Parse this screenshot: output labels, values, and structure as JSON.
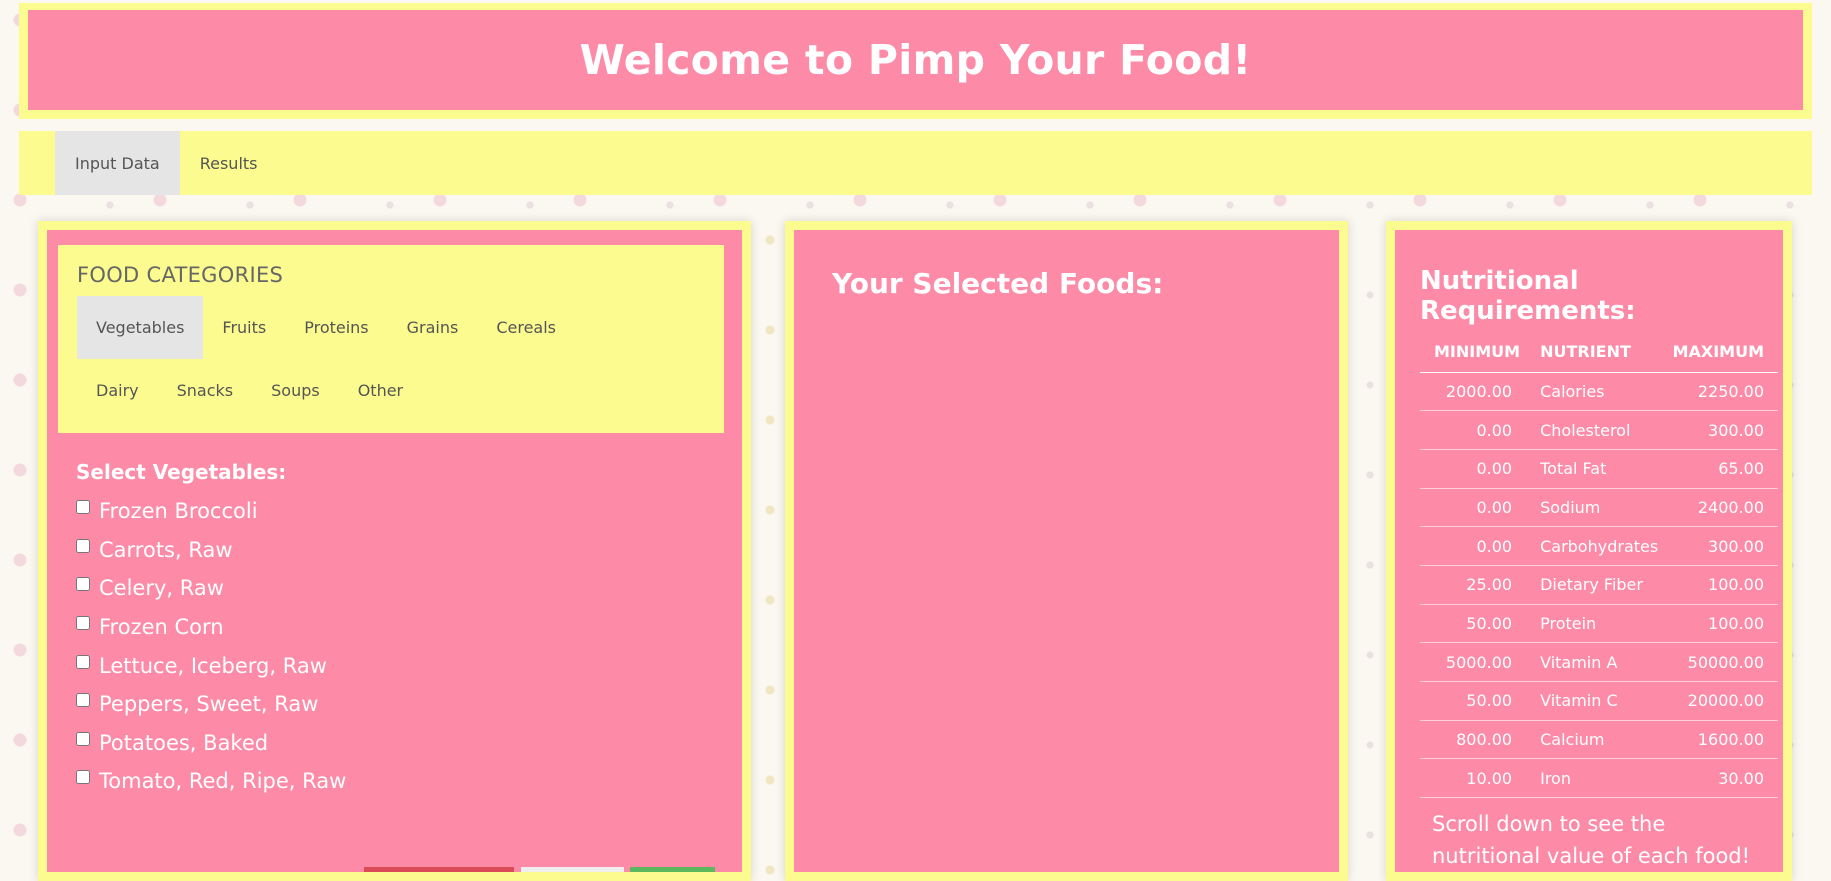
{
  "header": {
    "title": "Welcome to Pimp Your Food!"
  },
  "nav": {
    "tabs": [
      "Input Data",
      "Results"
    ]
  },
  "categories": {
    "title": "FOOD CATEGORIES",
    "tabs": [
      "Vegetables",
      "Fruits",
      "Proteins",
      "Grains",
      "Cereals",
      "Dairy",
      "Snacks",
      "Soups",
      "Other"
    ],
    "active": "Vegetables"
  },
  "selection": {
    "heading": "Select Vegetables:",
    "items": [
      "Frozen Broccoli",
      "Carrots, Raw",
      "Celery, Raw",
      "Frozen Corn",
      "Lettuce, Iceberg, Raw",
      "Peppers, Sweet, Raw",
      "Potatoes, Baked",
      "Tomato, Red, Ripe, Raw"
    ]
  },
  "selected": {
    "title": "Your Selected Foods:"
  },
  "requirements": {
    "title": "Nutritional Requirements:",
    "headers": {
      "min": "MINIMUM",
      "nutrient": "NUTRIENT",
      "max": "MAXIMUM"
    },
    "rows": [
      {
        "min": "2000.00",
        "nutrient": "Calories",
        "max": "2250.00"
      },
      {
        "min": "0.00",
        "nutrient": "Cholesterol",
        "max": "300.00"
      },
      {
        "min": "0.00",
        "nutrient": "Total Fat",
        "max": "65.00"
      },
      {
        "min": "0.00",
        "nutrient": "Sodium",
        "max": "2400.00"
      },
      {
        "min": "0.00",
        "nutrient": "Carbohydrates",
        "max": "300.00"
      },
      {
        "min": "25.00",
        "nutrient": "Dietary Fiber",
        "max": "100.00"
      },
      {
        "min": "50.00",
        "nutrient": "Protein",
        "max": "100.00"
      },
      {
        "min": "5000.00",
        "nutrient": "Vitamin A",
        "max": "50000.00"
      },
      {
        "min": "50.00",
        "nutrient": "Vitamin C",
        "max": "20000.00"
      },
      {
        "min": "800.00",
        "nutrient": "Calcium",
        "max": "1600.00"
      },
      {
        "min": "10.00",
        "nutrient": "Iron",
        "max": "30.00"
      }
    ],
    "note": "Scroll down to see the nutritional value of each food!"
  },
  "colors": {
    "pink": "#fd8ba8",
    "yellow": "#fbfb8f",
    "tab_active": "#e5e5e5"
  }
}
